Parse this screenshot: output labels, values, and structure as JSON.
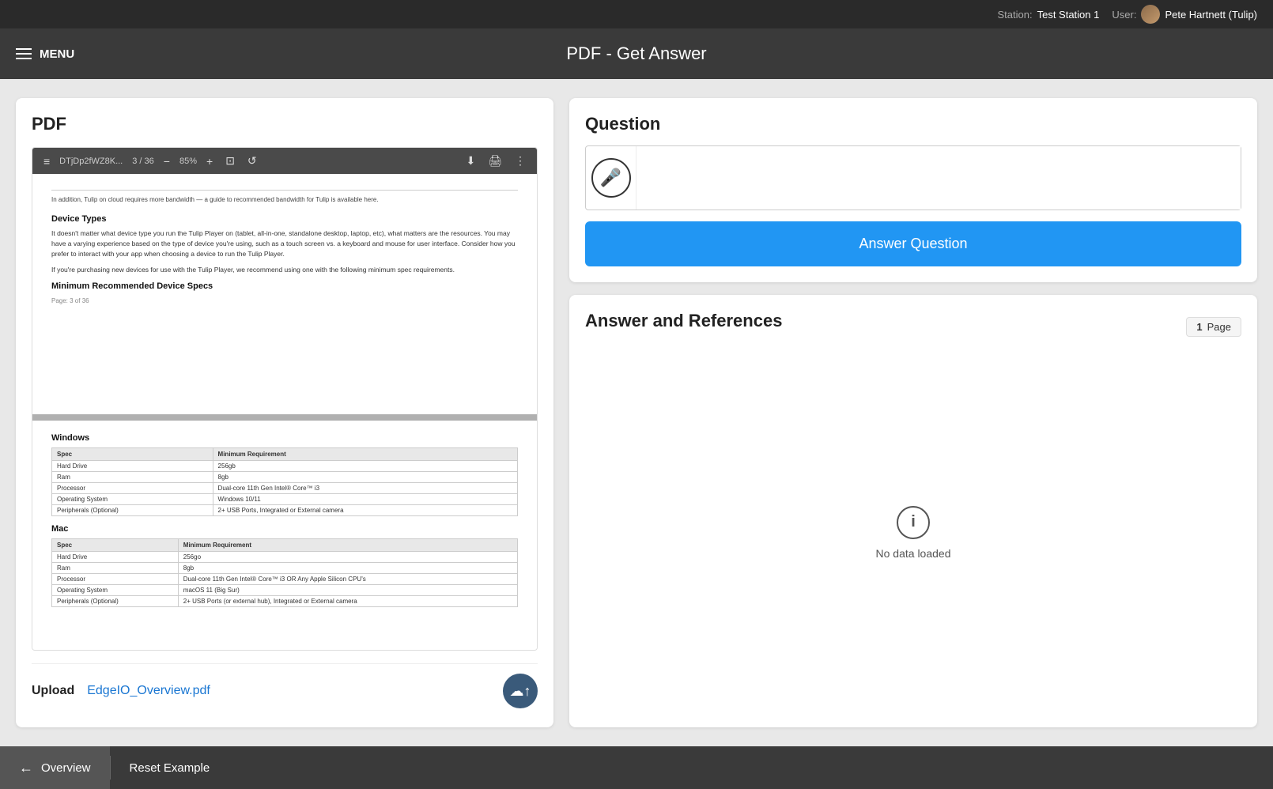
{
  "topbar": {
    "station_label": "Station:",
    "station_value": "Test Station 1",
    "user_label": "User:",
    "user_name": "Pete Hartnett (Tulip)"
  },
  "header": {
    "menu_label": "MENU",
    "title": "PDF - Get Answer"
  },
  "pdf_panel": {
    "label": "PDF",
    "toolbar": {
      "filename": "DTjDp2fWZ8K...",
      "pages": "3 / 36",
      "zoom": "85%",
      "minus": "−",
      "plus": "+",
      "fit_icon": "⊡",
      "rotate_icon": "↺",
      "download_icon": "⬇",
      "print_icon": "🖨",
      "more_icon": "⋮"
    },
    "page3_top_text": "In addition, Tulip on cloud requires more bandwidth — a guide to recommended bandwidth for Tulip is\navailable here.",
    "section_device_types": "Device Types",
    "device_types_body": "It doesn't matter what device type you run the Tulip Player on (tablet, all-in-one, standalone desktop,\nlaptop, etc), what matters are the resources. You may have a varying experience based on the type of\ndevice you're using, such as a touch screen vs. a keyboard and mouse for user interface. Consider\nhow you prefer to interact with your app when choosing a device to run the Tulip Player.",
    "device_types_body2": "If you're purchasing new devices for use with the Tulip Player, we recommend using one with the\nfollowing minimum spec requirements.",
    "section_min_specs": "Minimum Recommended Device Specs",
    "page_num": "Page: 3 of 36",
    "windows_title": "Windows",
    "windows_table_headers": [
      "Spec",
      "Minimum Requirement"
    ],
    "windows_rows": [
      [
        "Hard Drive",
        "256gb"
      ],
      [
        "Ram",
        "8gb"
      ],
      [
        "Processor",
        "Dual-core 11th Gen Intel® Core™ i3"
      ],
      [
        "Operating System",
        "Windows 10/11"
      ],
      [
        "Peripherals (Optional)",
        "2+ USB Ports, Integrated or External camera"
      ]
    ],
    "mac_title": "Mac",
    "mac_table_headers": [
      "Spec",
      "Minimum Requirement"
    ],
    "mac_rows": [
      [
        "Hard Drive",
        "256go"
      ],
      [
        "Ram",
        "8gb"
      ],
      [
        "Processor",
        "Dual-core 11th Gen Intel® Core™ i3 OR Any Apple Silicon CPU's"
      ],
      [
        "Operating System",
        "macOS 11 (Big Sur)"
      ],
      [
        "Peripherals (Optional)",
        "2+ USB Ports (or external hub), Integrated or External camera"
      ]
    ]
  },
  "upload": {
    "label": "Upload",
    "filename": "EdgeIO_Overview.pdf"
  },
  "question_panel": {
    "title": "Question",
    "placeholder": "",
    "answer_btn_label": "Answer Question",
    "mic_label": "microphone"
  },
  "answer_panel": {
    "title": "Answer and References",
    "page_badge_num": "1",
    "page_badge_label": "Page",
    "no_data_text": "No data loaded"
  },
  "bottom_bar": {
    "back_label": "Overview",
    "reset_label": "Reset Example"
  }
}
